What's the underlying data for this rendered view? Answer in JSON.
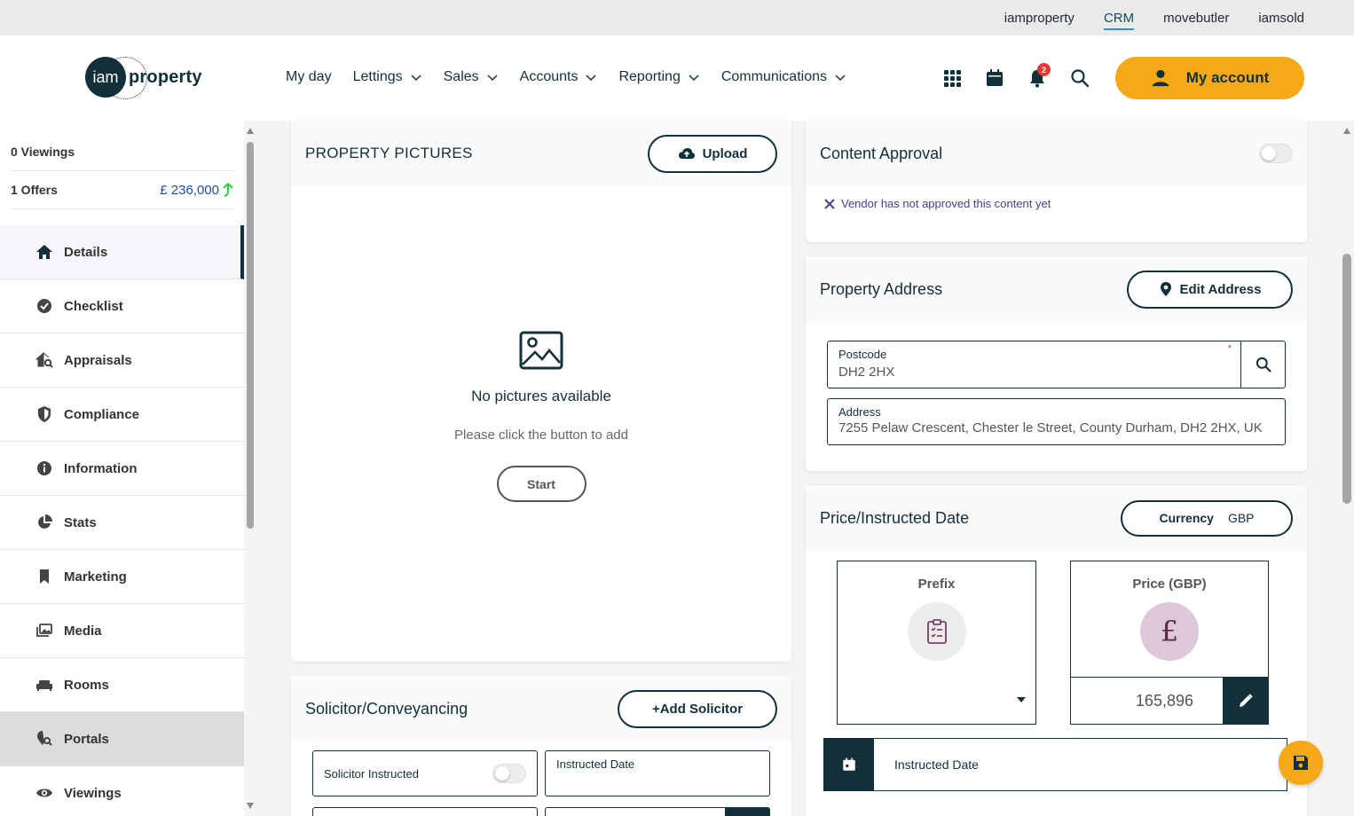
{
  "topbar": {
    "links": [
      "iamproperty",
      "CRM",
      "movebutler",
      "iamsold"
    ]
  },
  "header": {
    "logo": {
      "badge": "iam",
      "text": "property"
    },
    "nav": [
      "My day",
      "Lettings",
      "Sales",
      "Accounts",
      "Reporting",
      "Communications"
    ],
    "notification_count": "2",
    "account_label": "My account"
  },
  "sidebar": {
    "viewings": "0 Viewings",
    "offers": "1 Offers",
    "offer_value": "£ 236,000",
    "items": [
      "Details",
      "Checklist",
      "Appraisals",
      "Compliance",
      "Information",
      "Stats",
      "Marketing",
      "Media",
      "Rooms",
      "Portals",
      "Viewings"
    ]
  },
  "pictures": {
    "title": "PROPERTY PICTURES",
    "upload_label": "Upload",
    "empty_title": "No pictures available",
    "empty_text": "Please click the button to add",
    "start_label": "Start"
  },
  "solicitor": {
    "title": "Solicitor/Conveyancing",
    "add_label": "+Add Solicitor",
    "instructed_label": "Solicitor Instructed",
    "date_label": "Instructed Date"
  },
  "content_approval": {
    "title": "Content Approval",
    "status": "Vendor has not approved this content yet"
  },
  "address": {
    "title": "Property Address",
    "edit_label": "Edit Address",
    "postcode_label": "Postcode",
    "postcode_value": "DH2 2HX",
    "address_label": "Address",
    "address_value": "7255 Pelaw Crescent, Chester le Street, County Durham, DH2 2HX, UK"
  },
  "price": {
    "title": "Price/Instructed Date",
    "currency_label": "Currency",
    "currency_value": "GBP",
    "prefix_label": "Prefix",
    "price_label": "Price (GBP)",
    "price_value": "165,896",
    "instructed_date_label": "Instructed Date"
  },
  "colors": {
    "accent": "#f7a817",
    "primary": "#12303a",
    "link": "#1e4fa8"
  }
}
